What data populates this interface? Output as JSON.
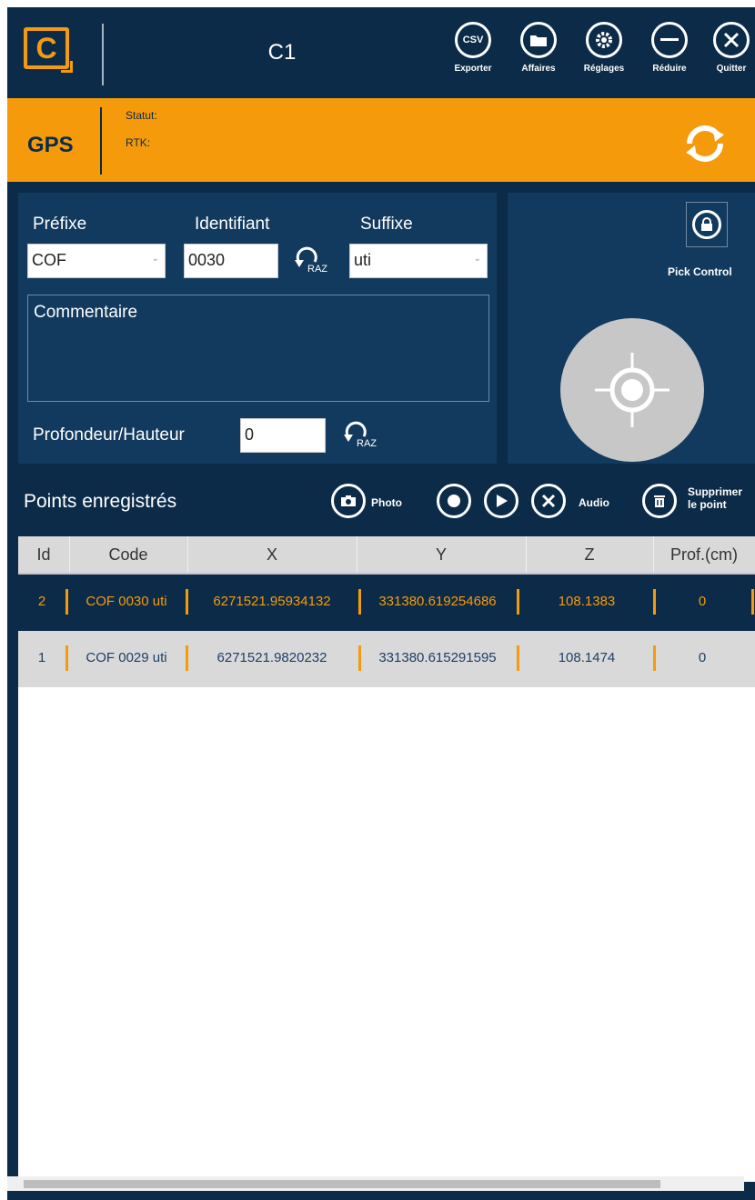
{
  "header": {
    "logo_letter": "C",
    "title": "C1",
    "buttons": [
      {
        "icon": "csv-export-icon",
        "glyph": "CSV",
        "label": "Exporter"
      },
      {
        "icon": "folder-icon",
        "glyph": "",
        "label": "Affaires"
      },
      {
        "icon": "gear-icon",
        "glyph": "",
        "label": "Réglages"
      },
      {
        "icon": "minus-icon",
        "glyph": "",
        "label": "Réduire"
      },
      {
        "icon": "close-icon",
        "glyph": "",
        "label": "Quitter"
      }
    ]
  },
  "gps": {
    "label": "GPS",
    "statut_label": "Statut:",
    "rtk_label": "RTK:"
  },
  "form": {
    "prefix_label": "Préfixe",
    "prefix_value": "COF",
    "id_label": "Identifiant",
    "id_value": "0030",
    "raz_label": "RAZ",
    "suffix_label": "Suffixe",
    "suffix_value": "uti",
    "comment_placeholder": "Commentaire",
    "depth_label": "Profondeur/Hauteur",
    "depth_value": "0"
  },
  "pick": {
    "label": "Pick Control"
  },
  "points": {
    "title": "Points enregistrés",
    "photo_label": "Photo",
    "audio_label": "Audio",
    "delete_label_1": "Supprimer",
    "delete_label_2": "le point",
    "columns": [
      "Id",
      "Code",
      "X",
      "Y",
      "Z",
      "Prof.(cm)"
    ],
    "rows": [
      {
        "id": "2",
        "code": "COF 0030 uti",
        "x": "6271521.95934132",
        "y": "331380.619254686",
        "z": "108.1383",
        "prof": "0"
      },
      {
        "id": "1",
        "code": "COF 0029 uti",
        "x": "6271521.9820232",
        "y": "331380.615291595",
        "z": "108.1474",
        "prof": "0"
      }
    ]
  },
  "colors": {
    "background": "#0c2b48",
    "panel": "#113a5e",
    "accent": "#f59b0b"
  }
}
